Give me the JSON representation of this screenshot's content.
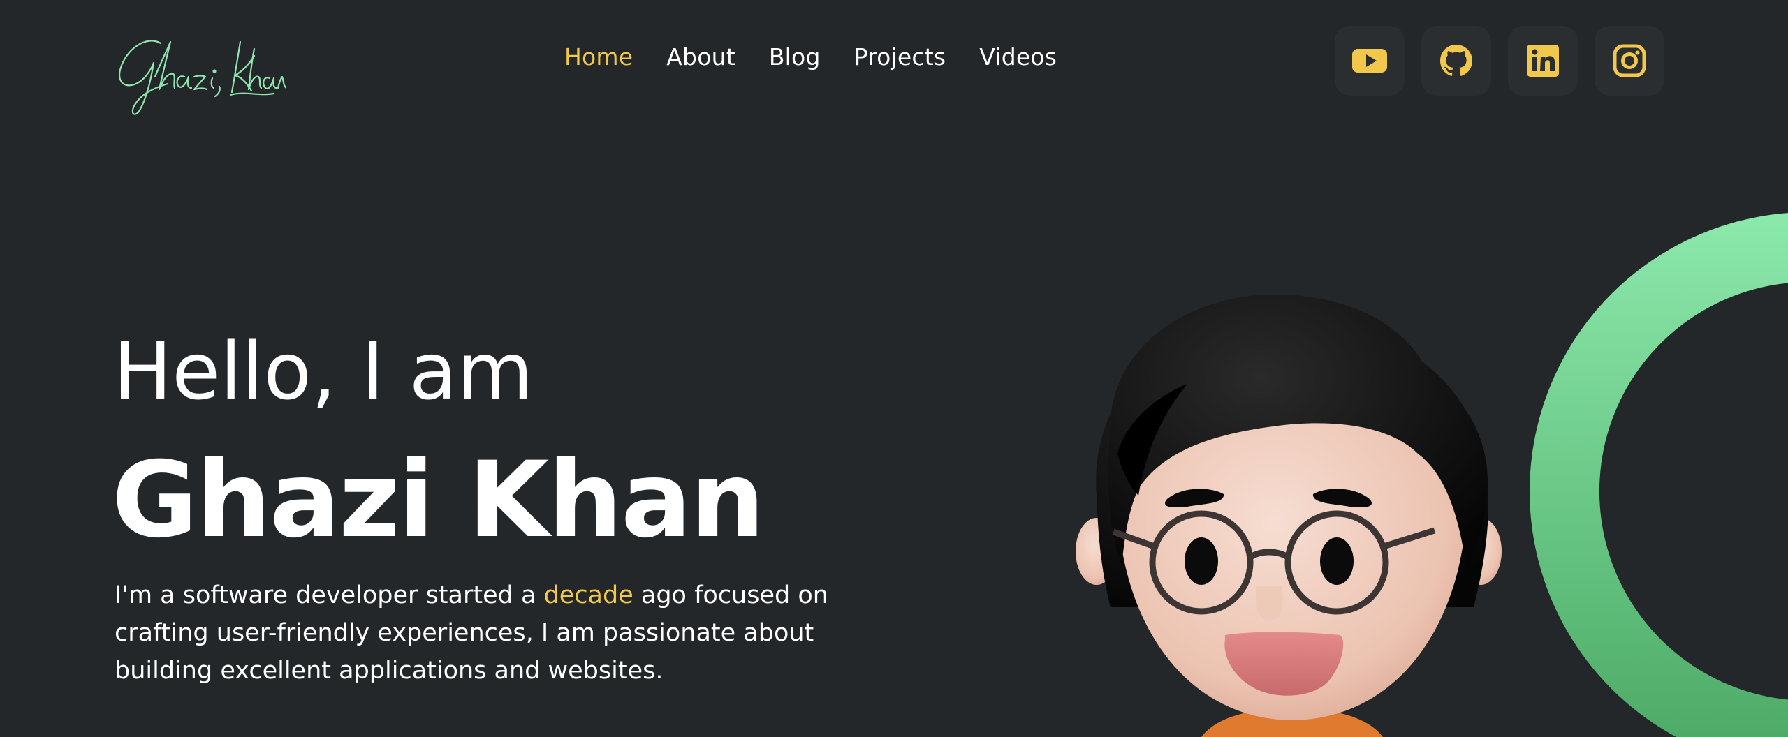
{
  "logo": {
    "text": "Ghazi Khan",
    "color": "#8fe6ae"
  },
  "nav": {
    "items": [
      {
        "label": "Home",
        "active": true
      },
      {
        "label": "About",
        "active": false
      },
      {
        "label": "Blog",
        "active": false
      },
      {
        "label": "Projects",
        "active": false
      },
      {
        "label": "Videos",
        "active": false
      }
    ]
  },
  "socials": [
    {
      "icon": "youtube-icon"
    },
    {
      "icon": "github-icon"
    },
    {
      "icon": "linkedin-icon"
    },
    {
      "icon": "instagram-icon"
    }
  ],
  "hero": {
    "greeting": "Hello, I am",
    "name": "Ghazi Khan",
    "desc_before": "I'm a software developer started a ",
    "desc_accent": "decade",
    "desc_after": " ago focused on crafting user-friendly experiences, I am passionate about building excellent applications and websites."
  },
  "colors": {
    "background": "#23272a",
    "accent": "#f1c84b",
    "ring_green": "#5fc383",
    "social_bg": "#2a2e31"
  }
}
